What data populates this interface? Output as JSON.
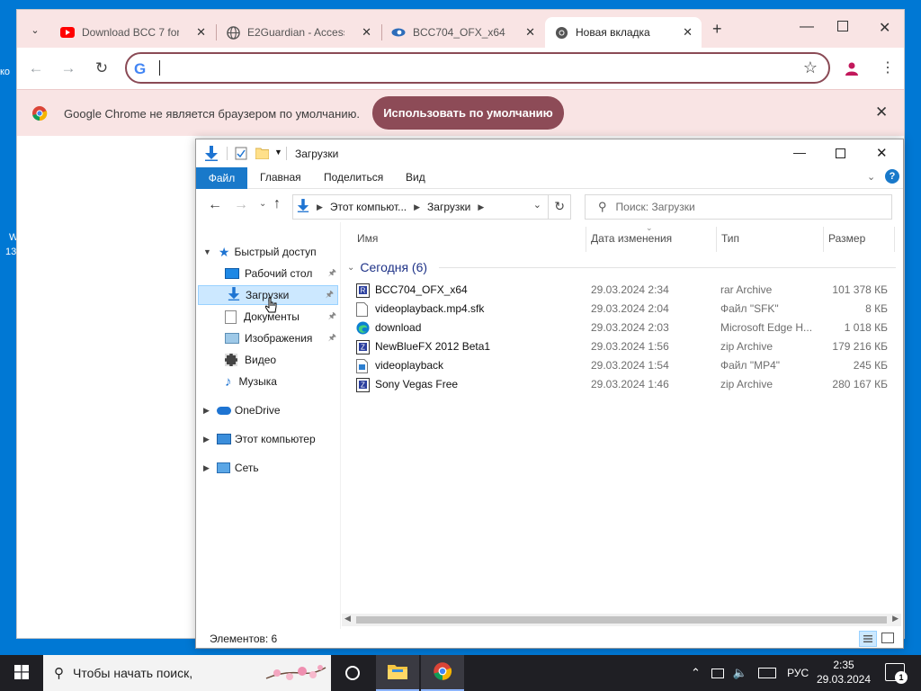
{
  "desktop": {
    "icon_labels": [
      "ко",
      "W",
      "13"
    ]
  },
  "chrome": {
    "tabs": [
      {
        "label": "Download BCC 7 for",
        "icon": "youtube-icon",
        "active": false
      },
      {
        "label": "E2Guardian - Access",
        "icon": "globe-icon",
        "active": false
      },
      {
        "label": "BCC704_OFX_x64",
        "icon": "eye-logo-icon",
        "active": false
      },
      {
        "label": "Новая вкладка",
        "icon": "chrome-icon",
        "active": true
      }
    ],
    "omnibox_value": "",
    "infobar": {
      "message": "Google Chrome не является браузером по умолчанию.",
      "button": "Использовать по умолчанию"
    }
  },
  "explorer": {
    "title": "Загрузки",
    "ribbon_tabs": [
      "Файл",
      "Главная",
      "Поделиться",
      "Вид"
    ],
    "address": {
      "part1": "Этот компьют...",
      "part2": "Загрузки"
    },
    "search_placeholder": "Поиск: Загрузки",
    "nav": {
      "quick_access": "Быстрый доступ",
      "items": [
        "Рабочий стол",
        "Загрузки",
        "Документы",
        "Изображения",
        "Видео",
        "Музыка"
      ],
      "onedrive": "OneDrive",
      "this_pc": "Этот компьютер",
      "network": "Сеть"
    },
    "columns": [
      "Имя",
      "Дата изменения",
      "Тип",
      "Размер"
    ],
    "group": "Сегодня (6)",
    "files": [
      {
        "name": "BCC704_OFX_x64",
        "date": "29.03.2024 2:34",
        "type": "rar Archive",
        "size": "101 378 КБ",
        "icon": "rar-archive-icon"
      },
      {
        "name": "videoplayback.mp4.sfk",
        "date": "29.03.2024 2:04",
        "type": "Файл \"SFK\"",
        "size": "8 КБ",
        "icon": "file-icon"
      },
      {
        "name": "download",
        "date": "29.03.2024 2:03",
        "type": "Microsoft Edge H...",
        "size": "1 018 КБ",
        "icon": "edge-icon"
      },
      {
        "name": "NewBlueFX 2012 Beta1",
        "date": "29.03.2024 1:56",
        "type": "zip Archive",
        "size": "179 216 КБ",
        "icon": "zip-archive-icon"
      },
      {
        "name": "videoplayback",
        "date": "29.03.2024 1:54",
        "type": "Файл \"MP4\"",
        "size": "245 КБ",
        "icon": "video-file-icon"
      },
      {
        "name": "Sony Vegas Free",
        "date": "29.03.2024 1:46",
        "type": "zip Archive",
        "size": "280 167 КБ",
        "icon": "zip-archive-icon"
      }
    ],
    "status": "Элементов: 6"
  },
  "taskbar": {
    "search_placeholder": "Чтобы начать поиск,",
    "lang": "РУС",
    "time": "2:35",
    "date": "29.03.2024",
    "notification_count": "1"
  }
}
